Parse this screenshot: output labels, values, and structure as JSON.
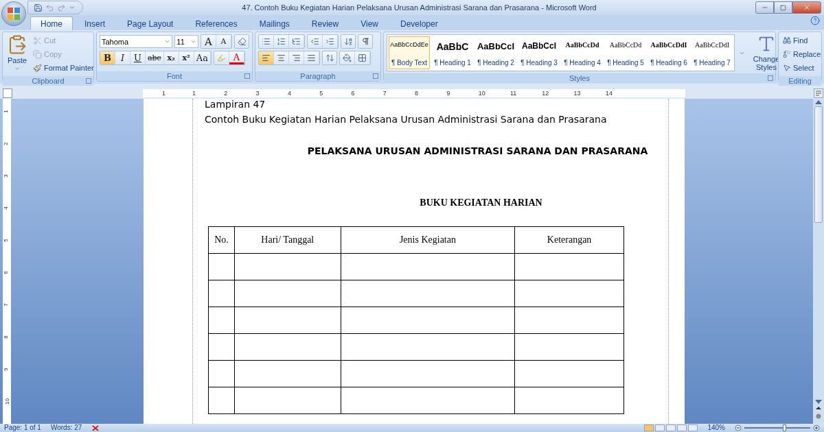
{
  "window": {
    "title": "47. Contoh Buku Kegiatan Harian Pelaksana Urusan Administrasi Sarana dan Prasarana - Microsoft Word"
  },
  "tabs": [
    {
      "label": "Home",
      "selected": true
    },
    {
      "label": "Insert",
      "selected": false
    },
    {
      "label": "Page Layout",
      "selected": false
    },
    {
      "label": "References",
      "selected": false
    },
    {
      "label": "Mailings",
      "selected": false
    },
    {
      "label": "Review",
      "selected": false
    },
    {
      "label": "View",
      "selected": false
    },
    {
      "label": "Developer",
      "selected": false
    }
  ],
  "clipboard": {
    "label": "Clipboard",
    "paste": "Paste",
    "items": [
      {
        "kind": "cut",
        "label": "Cut",
        "disabled": true
      },
      {
        "kind": "copy",
        "label": "Copy",
        "disabled": true
      },
      {
        "kind": "painter",
        "label": "Format Painter",
        "disabled": false
      }
    ]
  },
  "font": {
    "label": "Font",
    "name": "Tahoma",
    "size": "11",
    "grow": "A",
    "shrink": "A",
    "color_letter": "A",
    "format_buttons": [
      {
        "kind": "bold",
        "label": "B",
        "selected": true
      },
      {
        "kind": "italic",
        "label": "I",
        "selected": false
      },
      {
        "kind": "underline",
        "label": "U",
        "selected": false
      },
      {
        "kind": "strike",
        "label": "abc",
        "selected": false
      },
      {
        "kind": "sub",
        "label": "x₂",
        "selected": false
      },
      {
        "kind": "sup",
        "label": "x²",
        "selected": false
      },
      {
        "kind": "case",
        "label": "Aa",
        "selected": false
      }
    ]
  },
  "paragraph": {
    "label": "Paragraph",
    "align": [
      {
        "kind": "left",
        "selected": true
      },
      {
        "kind": "center",
        "selected": false
      },
      {
        "kind": "right",
        "selected": false
      },
      {
        "kind": "justify",
        "selected": false
      }
    ]
  },
  "styles": {
    "label": "Styles",
    "change": "Change Styles",
    "items": [
      {
        "sample": "AaBbCcDdEe",
        "name": "¶ Body Text",
        "kind": "plain",
        "selected": true
      },
      {
        "sample": "AaBbC",
        "name": "¶ Heading 1",
        "kind": "h1",
        "selected": false
      },
      {
        "sample": "AaBbCcI",
        "name": "¶ Heading 2",
        "kind": "h2",
        "selected": false
      },
      {
        "sample": "AaBbCcI",
        "name": "¶ Heading 3",
        "kind": "h3",
        "selected": false
      },
      {
        "sample": "AaBbCcDd",
        "name": "¶ Heading 4",
        "kind": "serifbold",
        "selected": false
      },
      {
        "sample": "AaBbCcDd",
        "name": "¶ Heading 5",
        "kind": "serif",
        "selected": false
      },
      {
        "sample": "AaBbCcDdI",
        "name": "¶ Heading 6",
        "kind": "serifbold",
        "selected": false
      },
      {
        "sample": "AaBbCcDdI",
        "name": "¶ Heading 7",
        "kind": "serif",
        "selected": false
      }
    ]
  },
  "editing": {
    "label": "Editing",
    "items": [
      {
        "kind": "find",
        "label": "Find"
      },
      {
        "kind": "replace",
        "label": "Replace"
      },
      {
        "kind": "select",
        "label": "Select"
      }
    ]
  },
  "ruler": {
    "left_numbers": [
      "1"
    ],
    "numbers": [
      "1",
      "2",
      "3",
      "4",
      "5",
      "6",
      "7",
      "8",
      "9",
      "10",
      "11",
      "12",
      "13",
      "14"
    ]
  },
  "vertical_ruler": {
    "numbers": [
      "1",
      "2",
      "3",
      "4",
      "5",
      "6",
      "7",
      "8",
      "9",
      "10"
    ]
  },
  "document": {
    "attachment": "Lampiran 47",
    "subtitle": "Contoh Buku Kegiatan Harian Pelaksana Urusan Administrasi Sarana dan Prasarana",
    "heading": "PELAKSANA URUSAN ADMINISTRASI SARANA DAN PRASARANA",
    "book_title": "BUKU KEGIATAN HARIAN",
    "table": {
      "columns": [
        "No.",
        "Hari/ Tanggal",
        "Jenis Kegiatan",
        "Keterangan"
      ],
      "rows": [
        {
          "kind": "blank"
        },
        {
          "kind": "blank"
        },
        {
          "kind": "blank"
        },
        {
          "kind": "blank"
        },
        {
          "kind": "blank"
        },
        {
          "kind": "blank"
        }
      ]
    }
  },
  "status_bar": {
    "page": "Page: 1 of 1",
    "words": "Words: 27",
    "zoom": "140%",
    "zoom_slider": {
      "level": 0.6
    },
    "views": [
      {
        "selected": true
      },
      {
        "selected": false
      },
      {
        "selected": false
      },
      {
        "selected": false
      },
      {
        "selected": false
      }
    ]
  }
}
